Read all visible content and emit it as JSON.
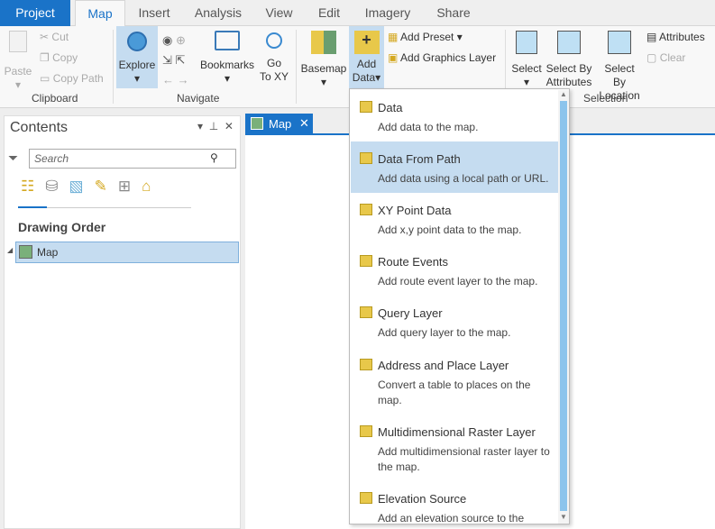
{
  "tabs": [
    "Project",
    "Map",
    "Insert",
    "Analysis",
    "View",
    "Edit",
    "Imagery",
    "Share"
  ],
  "ribbon": {
    "clipboard": {
      "paste": "Paste",
      "cut": "Cut",
      "copy": "Copy",
      "copy_path": "Copy Path",
      "label": "Clipboard"
    },
    "navigate": {
      "explore": "Explore",
      "bookmarks": "Bookmarks",
      "go": "Go",
      "to_xy": "To XY",
      "label": "Navigate"
    },
    "layer": {
      "basemap": "Basemap",
      "add": "Add",
      "data": "Data",
      "add_preset": "Add Preset",
      "add_graphics_layer": "Add Graphics Layer"
    },
    "selection": {
      "select": "Select",
      "select_by": "Select By",
      "attributes": "Attributes",
      "location": "Location",
      "attributes_btn": "Attributes",
      "clear": "Clear",
      "label": "Selection"
    }
  },
  "contents": {
    "title": "Contents",
    "search_placeholder": "Search",
    "drawing_order": "Drawing Order",
    "map_item": "Map"
  },
  "map_tab": {
    "label": "Map"
  },
  "add_data_menu": [
    {
      "title": "Data",
      "desc": "Add data to the map."
    },
    {
      "title": "Data From Path",
      "desc": "Add data using a local path or URL."
    },
    {
      "title": "XY Point Data",
      "desc": "Add x,y point data to the map."
    },
    {
      "title": "Route Events",
      "desc": "Add route event layer to the map."
    },
    {
      "title": "Query Layer",
      "desc": "Add query layer to the map."
    },
    {
      "title": "Address and Place Layer",
      "desc": "Convert a table to places on the map."
    },
    {
      "title": "Multidimensional Raster Layer",
      "desc": "Add multidimensional raster layer to the map."
    },
    {
      "title": "Elevation Source",
      "desc": "Add an elevation source to the"
    }
  ],
  "colors": {
    "accent": "#1a73c8",
    "highlight": "#c5dcf0"
  }
}
